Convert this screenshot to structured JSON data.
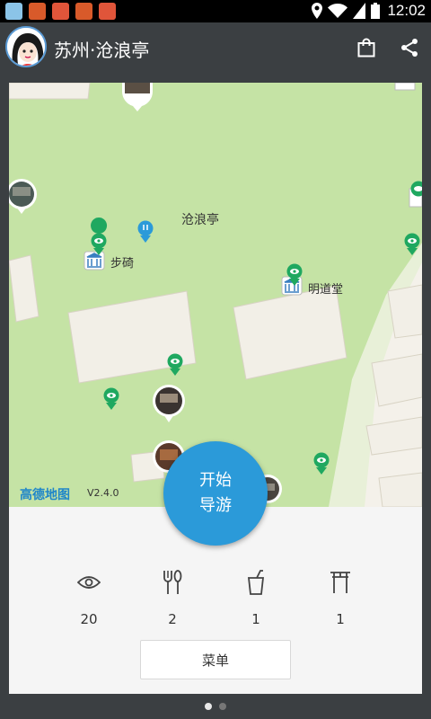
{
  "status_bar": {
    "time": "12:02",
    "icons": [
      "notification-app-icon",
      "notification-app-icon",
      "notification-app-icon",
      "notification-app-icon",
      "notification-app-icon",
      "location-icon",
      "wifi-icon",
      "sim-icon",
      "battery-icon"
    ]
  },
  "app_bar": {
    "title": "苏州·沧浪亭",
    "actions": [
      "bag-icon",
      "share-icon"
    ]
  },
  "map": {
    "labels": {
      "main": "沧浪亭",
      "buzhi": "步碕",
      "mingdaotang": "明道堂"
    },
    "logo": "高德地图",
    "version": "V2.4.0"
  },
  "start_button": {
    "line1": "开始",
    "line2": "导游"
  },
  "stats": [
    {
      "icon": "eye-icon",
      "value": "20"
    },
    {
      "icon": "utensils-icon",
      "value": "2"
    },
    {
      "icon": "drink-icon",
      "value": "1"
    },
    {
      "icon": "gate-icon",
      "value": "1"
    }
  ],
  "menu_button": "菜单",
  "pager": {
    "pages": 2,
    "active": 0
  },
  "colors": {
    "map_green": "#c5e3a5",
    "accent_blue": "#2b9ad9",
    "marker_green": "#1fa860",
    "appbar": "#3b3f42"
  }
}
